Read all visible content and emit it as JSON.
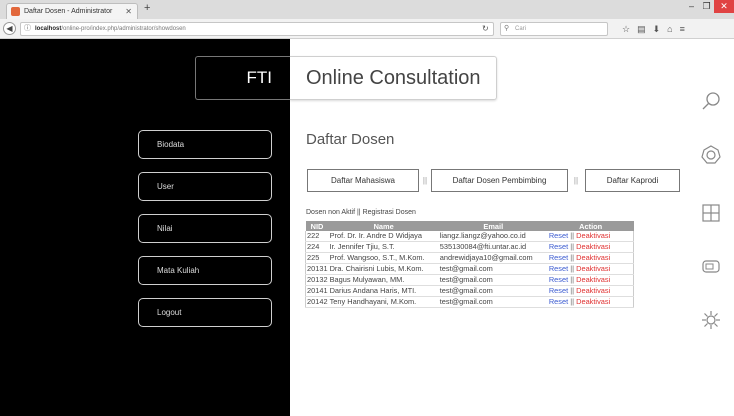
{
  "browser": {
    "tab_title": "Daftar Dosen - Administrator",
    "new_tab_symbol": "+",
    "url_host": "localhost",
    "url_path": "/online-pro/index.php/administrator/showdosen",
    "search_placeholder": "Cari",
    "win_min": "–",
    "win_max": "❐",
    "win_close": "✕"
  },
  "sidebar": {
    "brand": "FTI",
    "menu": [
      {
        "label": "Biodata"
      },
      {
        "label": "User"
      },
      {
        "label": "Nilai"
      },
      {
        "label": "Mata Kuliah"
      },
      {
        "label": "Logout"
      }
    ]
  },
  "app_title": "Online Consultation",
  "page_title": "Daftar Dosen",
  "tabs": [
    {
      "label": "Daftar Mahasiswa"
    },
    {
      "label": "Daftar Dosen Pembimbing"
    },
    {
      "label": "Daftar Kaprodi"
    }
  ],
  "tab_separator": "||",
  "sublinks": {
    "nonaktif": "Dosen non Aktif",
    "separator": "||",
    "registrasi": "Registrasi Dosen"
  },
  "table": {
    "headers": [
      "NID",
      "Name",
      "Email",
      "Action"
    ],
    "rows": [
      {
        "nid": "222",
        "name": "Prof. Dr. Ir. Andre D Widjaya",
        "email": "liangz.liangz@yahoo.co.id"
      },
      {
        "nid": "224",
        "name": "Ir. Jennifer Tjiu, S.T.",
        "email": "535130084@fti.untar.ac.id"
      },
      {
        "nid": "225",
        "name": "Prof. Wangsoo, S.T., M.Kom.",
        "email": "andrewidjaya10@gmail.com"
      },
      {
        "nid": "20131",
        "name": "Dra. Chairisni Lubis, M.Kom.",
        "email": "test@gmail.com"
      },
      {
        "nid": "20132",
        "name": "Bagus Mulyawan, MM.",
        "email": "test@gmail.com"
      },
      {
        "nid": "20141",
        "name": "Darius Andana Haris, MTI.",
        "email": "test@gmail.com"
      },
      {
        "nid": "20142",
        "name": "Teny Handhayani, M.Kom.",
        "email": "test@gmail.com"
      }
    ],
    "action_reset": "Reset",
    "action_separator": "||",
    "action_deactivate": "Deaktivasi"
  },
  "icons": [
    "search-icon",
    "settings-icon",
    "windows-start-icon",
    "devices-icon",
    "gear-icon"
  ]
}
